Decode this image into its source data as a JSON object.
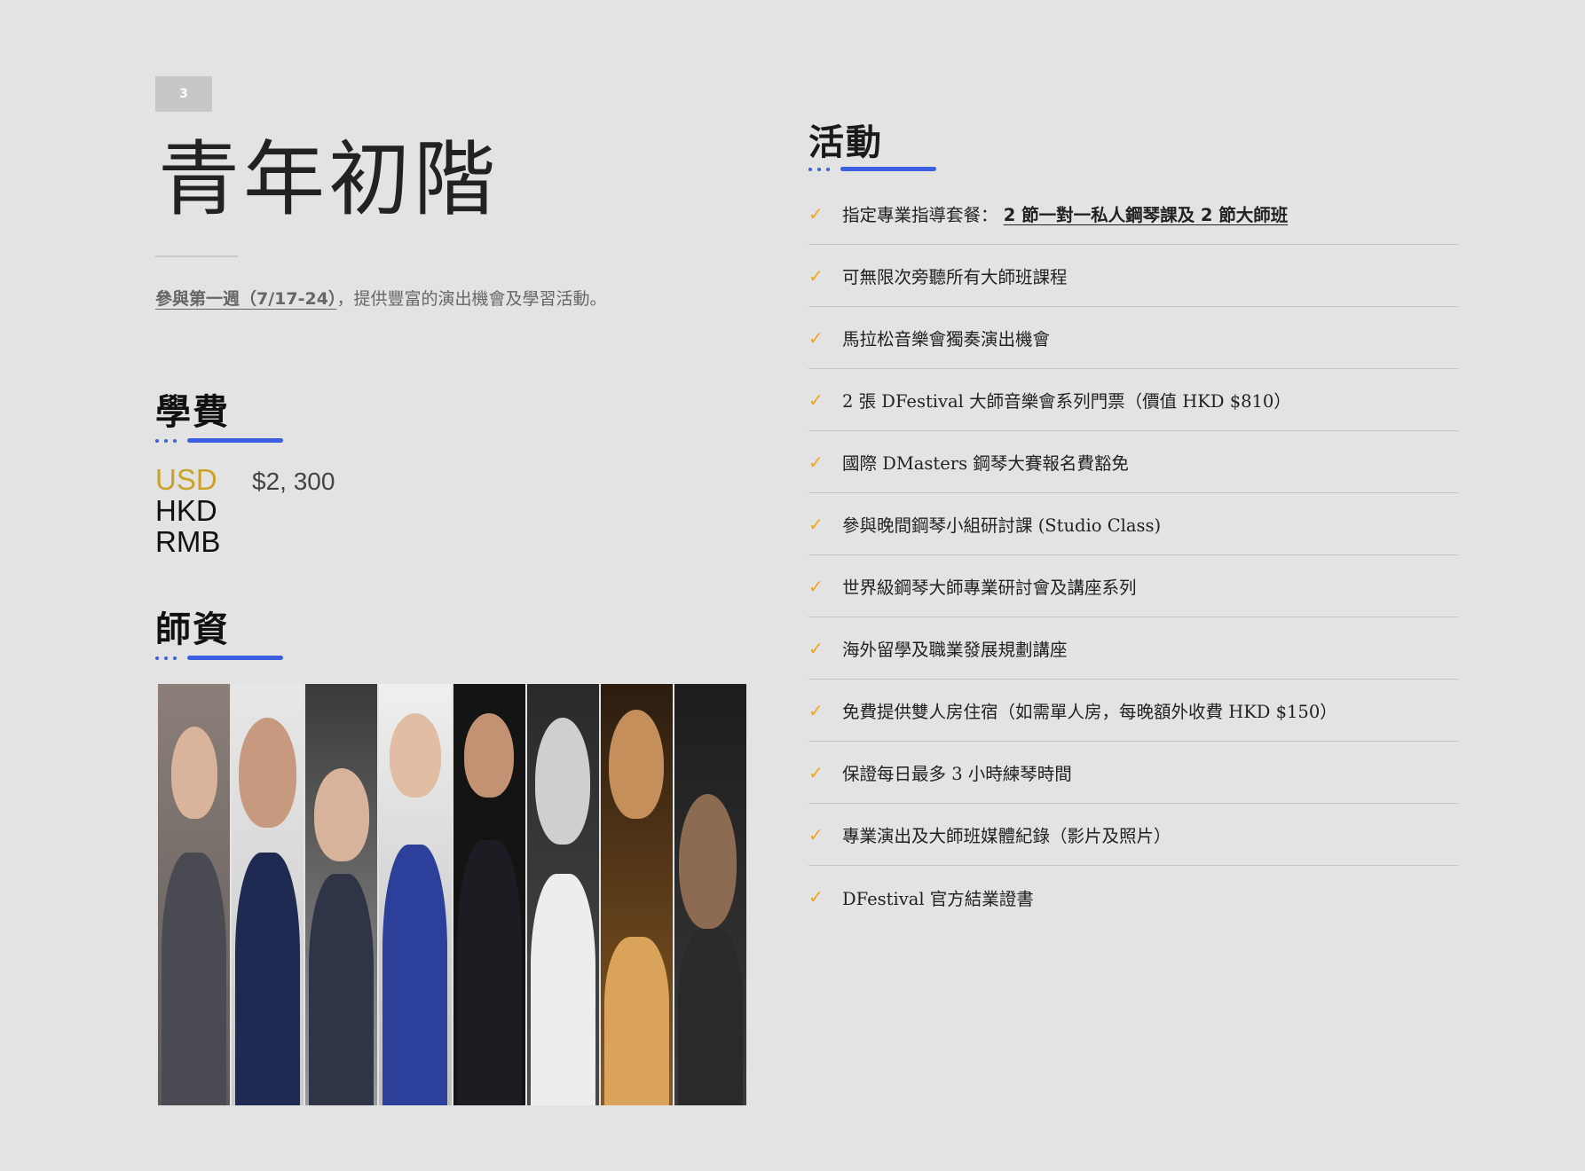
{
  "page": {
    "badge_number": "3"
  },
  "header": {
    "title": "青年初階",
    "subtitle_link": "參與第一週（7/17-24）",
    "subtitle_rest": "，提供豐富的演出機會及學習活動。"
  },
  "fees": {
    "heading": "學費",
    "rows": [
      {
        "currency": "USD",
        "amount": "$2, 300"
      },
      {
        "currency": "HKD",
        "amount": ""
      },
      {
        "currency": "RMB",
        "amount": ""
      }
    ]
  },
  "faculty": {
    "heading": "師資",
    "portrait_count": 8
  },
  "activities": {
    "heading": "活動",
    "items": [
      {
        "prefix": "指定專業指導套餐：",
        "highlight": "2 節一對一私人鋼琴課及 2 節大師班"
      },
      {
        "prefix": "可無限次旁聽所有大師班課程",
        "highlight": ""
      },
      {
        "prefix": "馬拉松音樂會獨奏演出機會",
        "highlight": ""
      },
      {
        "prefix": "2 張 DFestival 大師音樂會系列門票（價值 HKD $810）",
        "highlight": ""
      },
      {
        "prefix": "國際 DMasters 鋼琴大賽報名費豁免",
        "highlight": ""
      },
      {
        "prefix": "參與晚間鋼琴小組研討課 (Studio Class)",
        "highlight": ""
      },
      {
        "prefix": "世界級鋼琴大師專業研討會及講座系列",
        "highlight": ""
      },
      {
        "prefix": "海外留學及職業發展規劃講座",
        "highlight": ""
      },
      {
        "prefix": "免費提供雙人房住宿（如需單人房，每晚額外收費 HKD $150）",
        "highlight": ""
      },
      {
        "prefix": "保證每日最多 3 小時練琴時間",
        "highlight": ""
      },
      {
        "prefix": "專業演出及大師班媒體紀錄（影片及照片）",
        "highlight": ""
      },
      {
        "prefix": "DFestival 官方結業證書",
        "highlight": ""
      }
    ]
  },
  "colors": {
    "accent_blue": "#3b5fe0",
    "check_orange": "#f2a516",
    "usd_gold": "#c9a227"
  }
}
